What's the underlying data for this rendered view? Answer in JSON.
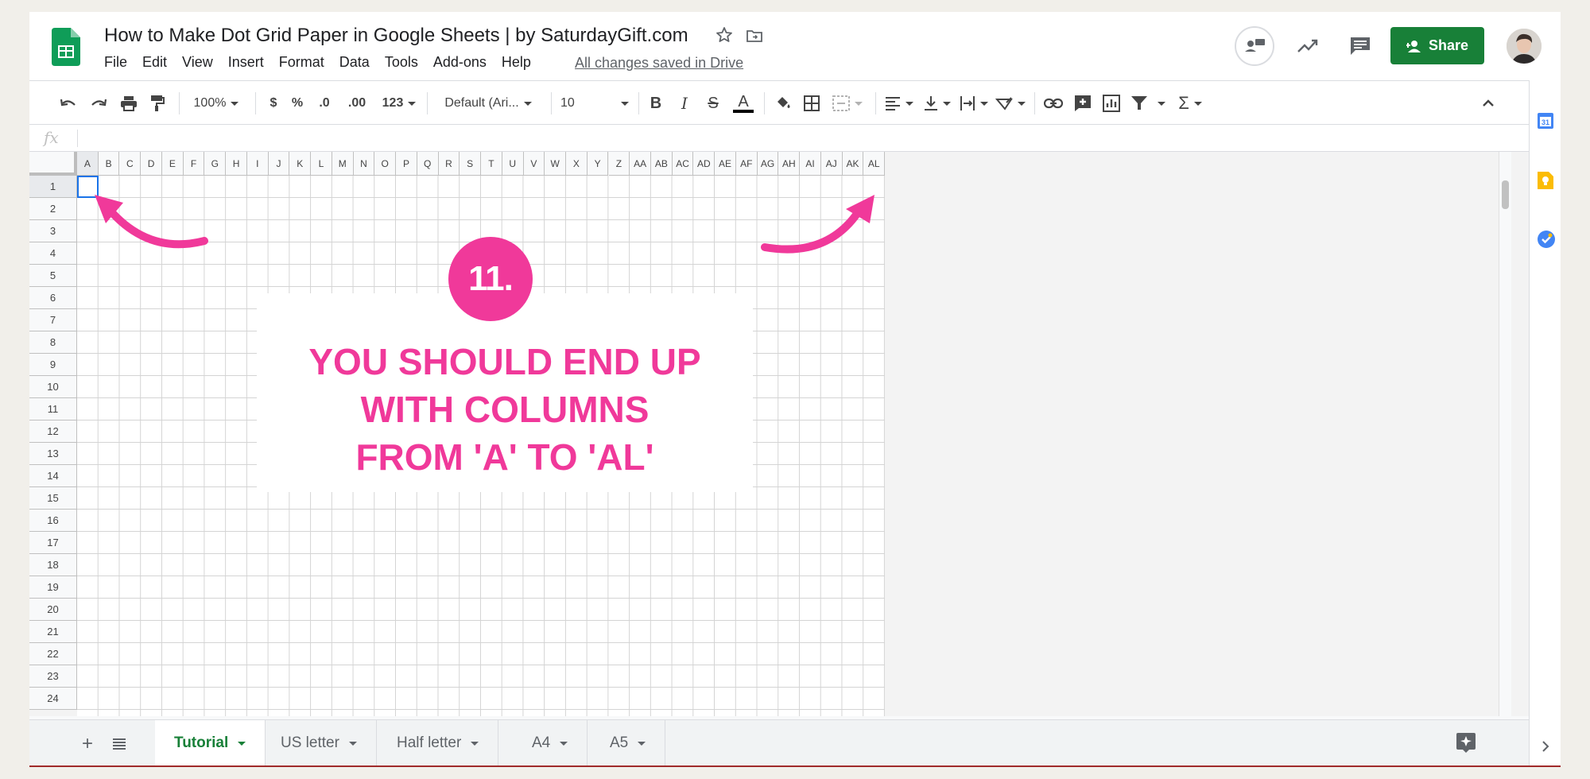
{
  "document": {
    "title": "How to Make Dot Grid Paper in Google Sheets | by SaturdayGift.com",
    "save_status": "All changes saved in Drive"
  },
  "menu": [
    "File",
    "Edit",
    "View",
    "Insert",
    "Format",
    "Data",
    "Tools",
    "Add-ons",
    "Help"
  ],
  "header": {
    "share_label": "Share"
  },
  "toolbar": {
    "zoom": "100%",
    "currency": "$",
    "percent": "%",
    "decrease_decimal": ".0",
    "increase_decimal": ".00",
    "more_formats": "123",
    "font_family": "Default (Ari...",
    "font_size": "10",
    "bold": "B",
    "italic": "I",
    "strike": "S",
    "text_color": "A",
    "functions": "Σ"
  },
  "formula_bar": {
    "label": "fx",
    "value": ""
  },
  "columns": [
    "A",
    "B",
    "C",
    "D",
    "E",
    "F",
    "G",
    "H",
    "I",
    "J",
    "K",
    "L",
    "M",
    "N",
    "O",
    "P",
    "Q",
    "R",
    "S",
    "T",
    "U",
    "V",
    "W",
    "X",
    "Y",
    "Z",
    "AA",
    "AB",
    "AC",
    "AD",
    "AE",
    "AF",
    "AG",
    "AH",
    "AI",
    "AJ",
    "AK",
    "AL"
  ],
  "rows": [
    "1",
    "2",
    "3",
    "4",
    "5",
    "6",
    "7",
    "8",
    "9",
    "10",
    "11",
    "12",
    "13",
    "14",
    "15",
    "16",
    "17",
    "18",
    "19",
    "20",
    "21",
    "22",
    "23",
    "24"
  ],
  "selected_cell": "A1",
  "overlay": {
    "step": "11.",
    "lines": [
      "YOU SHOULD END UP",
      "WITH COLUMNS",
      "FROM 'A' TO 'AL'"
    ]
  },
  "sheets": [
    {
      "label": "Tutorial",
      "active": true
    },
    {
      "label": "US letter",
      "active": false
    },
    {
      "label": "Half letter",
      "active": false
    },
    {
      "label": "A4",
      "active": false
    },
    {
      "label": "A5",
      "active": false
    }
  ],
  "side_panel": {
    "calendar_day": "31"
  },
  "colors": {
    "brand_green": "#188038",
    "accent_pink": "#f0399a",
    "selection_blue": "#1a73e8"
  }
}
